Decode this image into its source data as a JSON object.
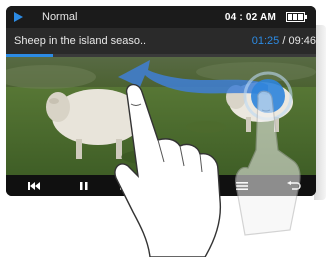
{
  "status": {
    "mode": "Normal",
    "clock": "04 : 02 AM"
  },
  "now_playing": {
    "title": "Sheep in the island seaso..",
    "elapsed": "01:25",
    "separator": " / ",
    "total": "09:46",
    "progress_fraction": 0.15
  },
  "controls": {
    "icons": [
      "skip-previous-icon",
      "pause-icon",
      "skip-next-icon",
      "menu-icon",
      "back-icon"
    ]
  },
  "colors": {
    "accent": "#2c8be4",
    "swipe_arrow": "#3f7fd6"
  }
}
